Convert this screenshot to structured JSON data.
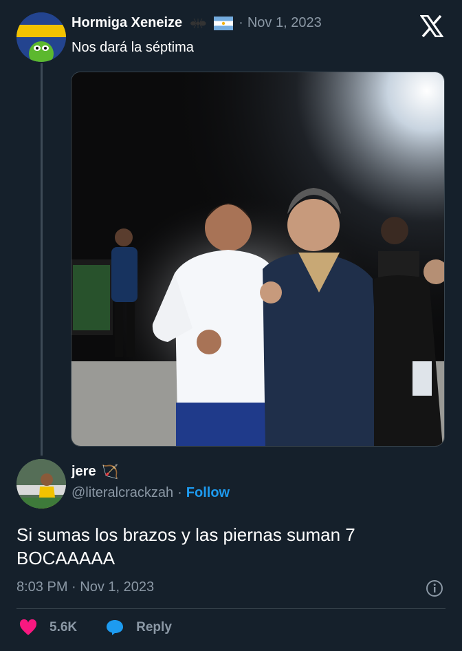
{
  "quoted": {
    "author_name": "Hormiga Xeneize",
    "date": "Nov 1, 2023",
    "dot": "·",
    "text": "Nos dará la séptima",
    "badge_icons": [
      "ant-icon",
      "argentina-flag-icon"
    ]
  },
  "tweet": {
    "author_name": "jere",
    "name_emoji": "🏹",
    "handle": "@literalcrackzah",
    "separator": "·",
    "follow_label": "Follow",
    "text": "Si sumas los brazos y las piernas suman 7\nBOCAAAAA",
    "timestamp": "8:03 PM · Nov 1, 2023",
    "likes": "5.6K",
    "reply_label": "Reply"
  },
  "colors": {
    "background": "#15202b",
    "accent": "#1d9bf0",
    "like": "#f91880",
    "muted": "#8b98a5"
  }
}
